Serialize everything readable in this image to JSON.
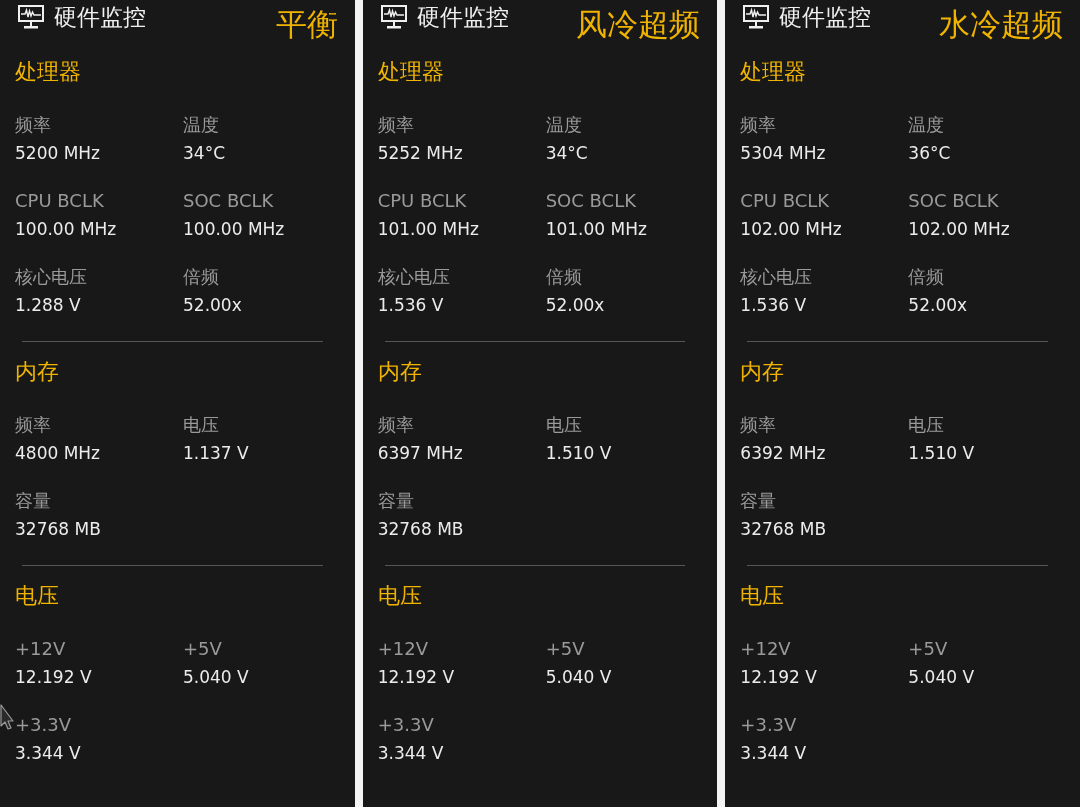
{
  "panels": [
    {
      "title": "硬件监控",
      "mode": "平衡",
      "sections": [
        {
          "title": "处理器",
          "items": [
            {
              "label": "频率",
              "value": "5200 MHz"
            },
            {
              "label": "温度",
              "value": "34°C"
            },
            {
              "label": "CPU BCLK",
              "value": "100.00 MHz"
            },
            {
              "label": "SOC BCLK",
              "value": "100.00 MHz"
            },
            {
              "label": "核心电压",
              "value": "1.288 V"
            },
            {
              "label": "倍频",
              "value": "52.00x"
            }
          ]
        },
        {
          "title": "内存",
          "items": [
            {
              "label": "频率",
              "value": "4800 MHz"
            },
            {
              "label": "电压",
              "value": "1.137 V"
            },
            {
              "label": "容量",
              "value": "32768 MB"
            }
          ]
        },
        {
          "title": "电压",
          "items": [
            {
              "label": "+12V",
              "value": "12.192 V"
            },
            {
              "label": "+5V",
              "value": "5.040 V"
            },
            {
              "label": "+3.3V",
              "value": "3.344 V"
            }
          ]
        }
      ]
    },
    {
      "title": "硬件监控",
      "mode": "风冷超频",
      "sections": [
        {
          "title": "处理器",
          "items": [
            {
              "label": "频率",
              "value": "5252 MHz"
            },
            {
              "label": "温度",
              "value": "34°C"
            },
            {
              "label": "CPU BCLK",
              "value": "101.00 MHz"
            },
            {
              "label": "SOC BCLK",
              "value": "101.00 MHz"
            },
            {
              "label": "核心电压",
              "value": "1.536 V"
            },
            {
              "label": "倍频",
              "value": "52.00x"
            }
          ]
        },
        {
          "title": "内存",
          "items": [
            {
              "label": "频率",
              "value": "6397 MHz"
            },
            {
              "label": "电压",
              "value": "1.510 V"
            },
            {
              "label": "容量",
              "value": "32768 MB"
            }
          ]
        },
        {
          "title": "电压",
          "items": [
            {
              "label": "+12V",
              "value": "12.192 V"
            },
            {
              "label": "+5V",
              "value": "5.040 V"
            },
            {
              "label": "+3.3V",
              "value": "3.344 V"
            }
          ]
        }
      ]
    },
    {
      "title": "硬件监控",
      "mode": "水冷超频",
      "sections": [
        {
          "title": "处理器",
          "items": [
            {
              "label": "频率",
              "value": "5304 MHz"
            },
            {
              "label": "温度",
              "value": "36°C"
            },
            {
              "label": "CPU BCLK",
              "value": "102.00 MHz"
            },
            {
              "label": "SOC BCLK",
              "value": "102.00 MHz"
            },
            {
              "label": "核心电压",
              "value": "1.536 V"
            },
            {
              "label": "倍频",
              "value": "52.00x"
            }
          ]
        },
        {
          "title": "内存",
          "items": [
            {
              "label": "频率",
              "value": "6392 MHz"
            },
            {
              "label": "电压",
              "value": "1.510 V"
            },
            {
              "label": "容量",
              "value": "32768 MB"
            }
          ]
        },
        {
          "title": "电压",
          "items": [
            {
              "label": "+12V",
              "value": "12.192 V"
            },
            {
              "label": "+5V",
              "value": "5.040 V"
            },
            {
              "label": "+3.3V",
              "value": "3.344 V"
            }
          ]
        }
      ]
    }
  ]
}
